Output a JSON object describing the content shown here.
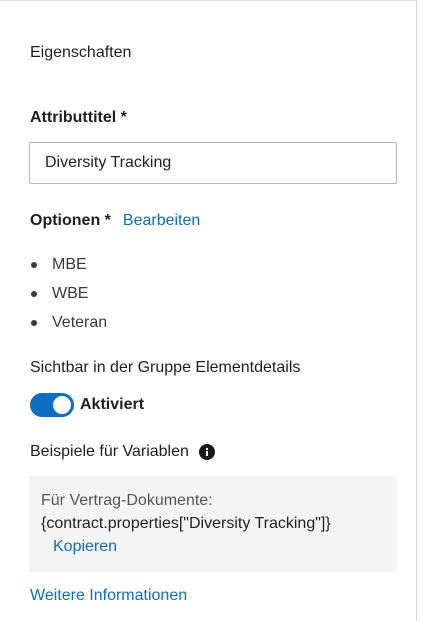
{
  "panel": {
    "section_title": "Eigenschaften",
    "attribute_title_label": "Attributtitel *",
    "attribute_title_value": "Diversity Tracking",
    "options_label": "Optionen *",
    "options_edit_link": "Bearbeiten",
    "options": [
      {
        "label": "MBE"
      },
      {
        "label": "WBE"
      },
      {
        "label": "Veteran"
      }
    ],
    "visibility_label": "Sichtbar in der Gruppe Elementdetails",
    "toggle": {
      "state": true,
      "label": "Aktiviert"
    },
    "variables_heading": "Beispiele für Variablen",
    "variables_info_icon": "info-icon",
    "variables_box": {
      "line1": "Für Vertrag-Dokumente:",
      "line2": "{contract.properties[\"Diversity Tracking\"]}",
      "copy_label": "Kopieren"
    },
    "more_info_link": "Weitere Informationen"
  },
  "colors": {
    "accent": "#0f6ebf",
    "text": "#1f1f1f",
    "muted_text": "#3a3a3a",
    "code_box_bg": "#f4f4f4",
    "input_border": "#b8b8b8"
  }
}
